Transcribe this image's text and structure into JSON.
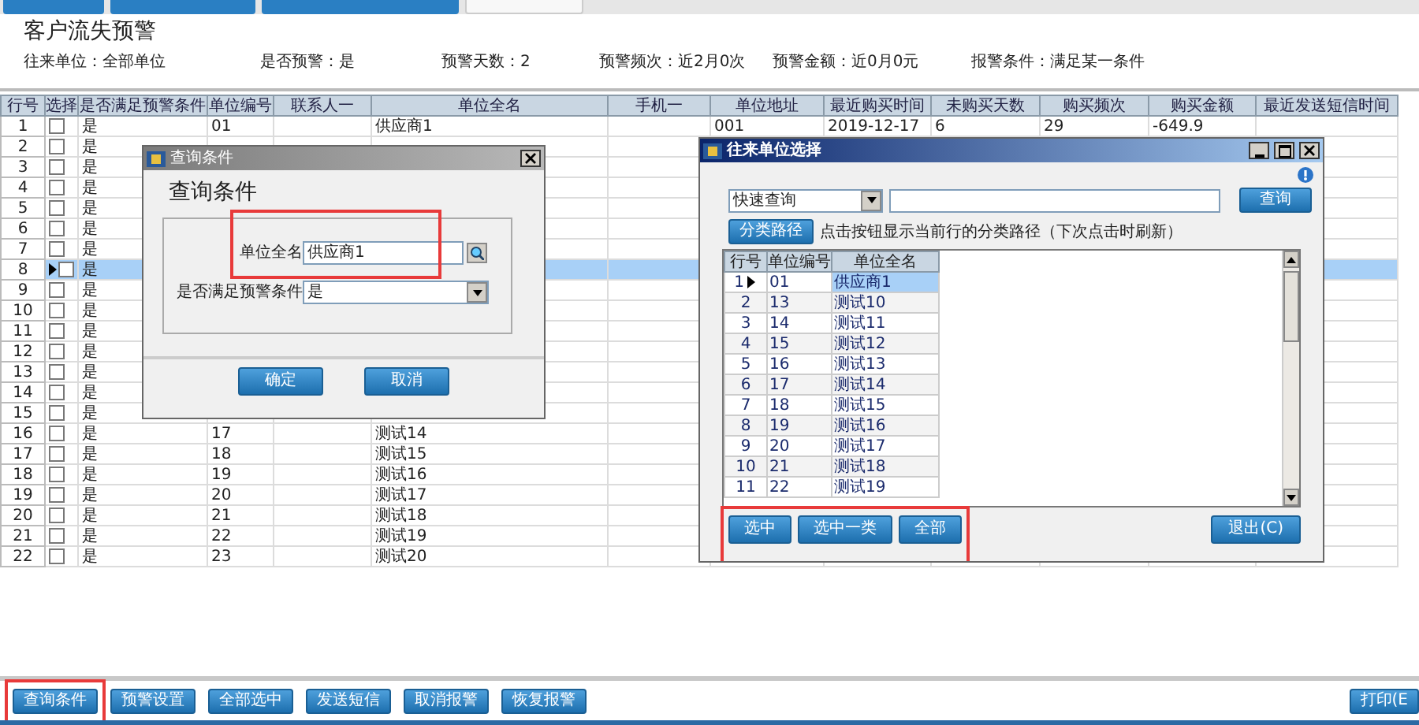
{
  "tabs": [
    {
      "selected": false
    },
    {
      "selected": false
    },
    {
      "selected": false
    },
    {
      "selected": true
    }
  ],
  "title": "客户流失预警",
  "filters": [
    "往来单位：全部单位",
    "是否预警：是",
    "预警天数：2",
    "预警频次：近2月0次",
    "预警金额：近0月0元",
    "报警条件：满足某一条件"
  ],
  "grid": {
    "columns": [
      "行号",
      "选择",
      "是否满足预警条件",
      "单位编号",
      "联系人一",
      "单位全名",
      "手机一",
      "单位地址",
      "最近购买时间",
      "未购买天数",
      "购买频次",
      "购买金额",
      "最近发送短信时间"
    ],
    "rows": [
      {
        "no": "1",
        "checked": false,
        "selected": false,
        "warn": "是",
        "code": "01",
        "name": "供应商1",
        "address": "001",
        "last_purchase": "2019-12-17",
        "days": "6",
        "frequency": "29",
        "amount": "-649.9"
      },
      {
        "no": "2",
        "checked": false,
        "selected": false,
        "warn": "是"
      },
      {
        "no": "3",
        "checked": false,
        "selected": false,
        "warn": "是"
      },
      {
        "no": "4",
        "checked": false,
        "selected": false,
        "warn": "是"
      },
      {
        "no": "5",
        "checked": false,
        "selected": false,
        "warn": "是"
      },
      {
        "no": "6",
        "checked": false,
        "selected": false,
        "warn": "是"
      },
      {
        "no": "7",
        "checked": false,
        "selected": false,
        "warn": "是"
      },
      {
        "no": "8",
        "checked": false,
        "selected": true,
        "warn": "是"
      },
      {
        "no": "9",
        "checked": false,
        "selected": false,
        "warn": "是"
      },
      {
        "no": "10",
        "checked": false,
        "selected": false,
        "warn": "是"
      },
      {
        "no": "11",
        "checked": false,
        "selected": false,
        "warn": "是"
      },
      {
        "no": "12",
        "checked": false,
        "selected": false,
        "warn": "是"
      },
      {
        "no": "13",
        "checked": false,
        "selected": false,
        "warn": "是"
      },
      {
        "no": "14",
        "checked": false,
        "selected": false,
        "warn": "是"
      },
      {
        "no": "15",
        "checked": false,
        "selected": false,
        "warn": "是"
      },
      {
        "no": "16",
        "checked": false,
        "selected": false,
        "warn": "是",
        "code": "17",
        "name": "测试14"
      },
      {
        "no": "17",
        "checked": false,
        "selected": false,
        "warn": "是",
        "code": "18",
        "name": "测试15"
      },
      {
        "no": "18",
        "checked": false,
        "selected": false,
        "warn": "是",
        "code": "19",
        "name": "测试16"
      },
      {
        "no": "19",
        "checked": false,
        "selected": false,
        "warn": "是",
        "code": "20",
        "name": "测试17"
      },
      {
        "no": "20",
        "checked": false,
        "selected": false,
        "warn": "是",
        "code": "21",
        "name": "测试18"
      },
      {
        "no": "21",
        "checked": false,
        "selected": false,
        "warn": "是",
        "code": "22",
        "name": "测试19"
      },
      {
        "no": "22",
        "checked": false,
        "selected": false,
        "warn": "是",
        "code": "23",
        "name": "测试20"
      }
    ]
  },
  "query_dialog": {
    "title": "查询条件",
    "heading": "查询条件",
    "fields_highlighted": true,
    "fields": [
      {
        "kind": "search",
        "label": "单位全名",
        "value": "供应商1"
      },
      {
        "kind": "dropdown",
        "label": "是否满足预警条件",
        "value": "是"
      }
    ],
    "buttons": [
      "确定",
      "取消"
    ]
  },
  "select_dialog": {
    "title": "往来单位选择",
    "mode": "快速查询",
    "search_button": "查询",
    "path_button": "分类路径",
    "hint": "点击按钮显示当前行的分类路径（下次点击时刷新）",
    "columns": [
      "行号",
      "单位编号",
      "单位全名"
    ],
    "rows": [
      {
        "no": "1",
        "code": "01",
        "name": "供应商1",
        "selected": true
      },
      {
        "no": "2",
        "code": "13",
        "name": "测试10",
        "selected": false
      },
      {
        "no": "3",
        "code": "14",
        "name": "测试11",
        "selected": false
      },
      {
        "no": "4",
        "code": "15",
        "name": "测试12",
        "selected": false
      },
      {
        "no": "5",
        "code": "16",
        "name": "测试13",
        "selected": false
      },
      {
        "no": "6",
        "code": "17",
        "name": "测试14",
        "selected": false
      },
      {
        "no": "7",
        "code": "18",
        "name": "测试15",
        "selected": false
      },
      {
        "no": "8",
        "code": "19",
        "name": "测试16",
        "selected": false
      },
      {
        "no": "9",
        "code": "20",
        "name": "测试17",
        "selected": false
      },
      {
        "no": "10",
        "code": "21",
        "name": "测试18",
        "selected": false
      },
      {
        "no": "11",
        "code": "22",
        "name": "测试19",
        "selected": false
      }
    ],
    "buttons": [
      "选中",
      "选中一类",
      "全部"
    ],
    "buttons_highlighted": true,
    "exit_button": "退出(C)"
  },
  "bottom_buttons": [
    {
      "label": "查询条件",
      "highlighted": true
    },
    {
      "label": "预警设置",
      "highlighted": false
    },
    {
      "label": "全部选中",
      "highlighted": false
    },
    {
      "label": "发送短信",
      "highlighted": false
    },
    {
      "label": "取消报警",
      "highlighted": false
    },
    {
      "label": "恢复报警",
      "highlighted": false
    }
  ],
  "print_button": "打印(E"
}
